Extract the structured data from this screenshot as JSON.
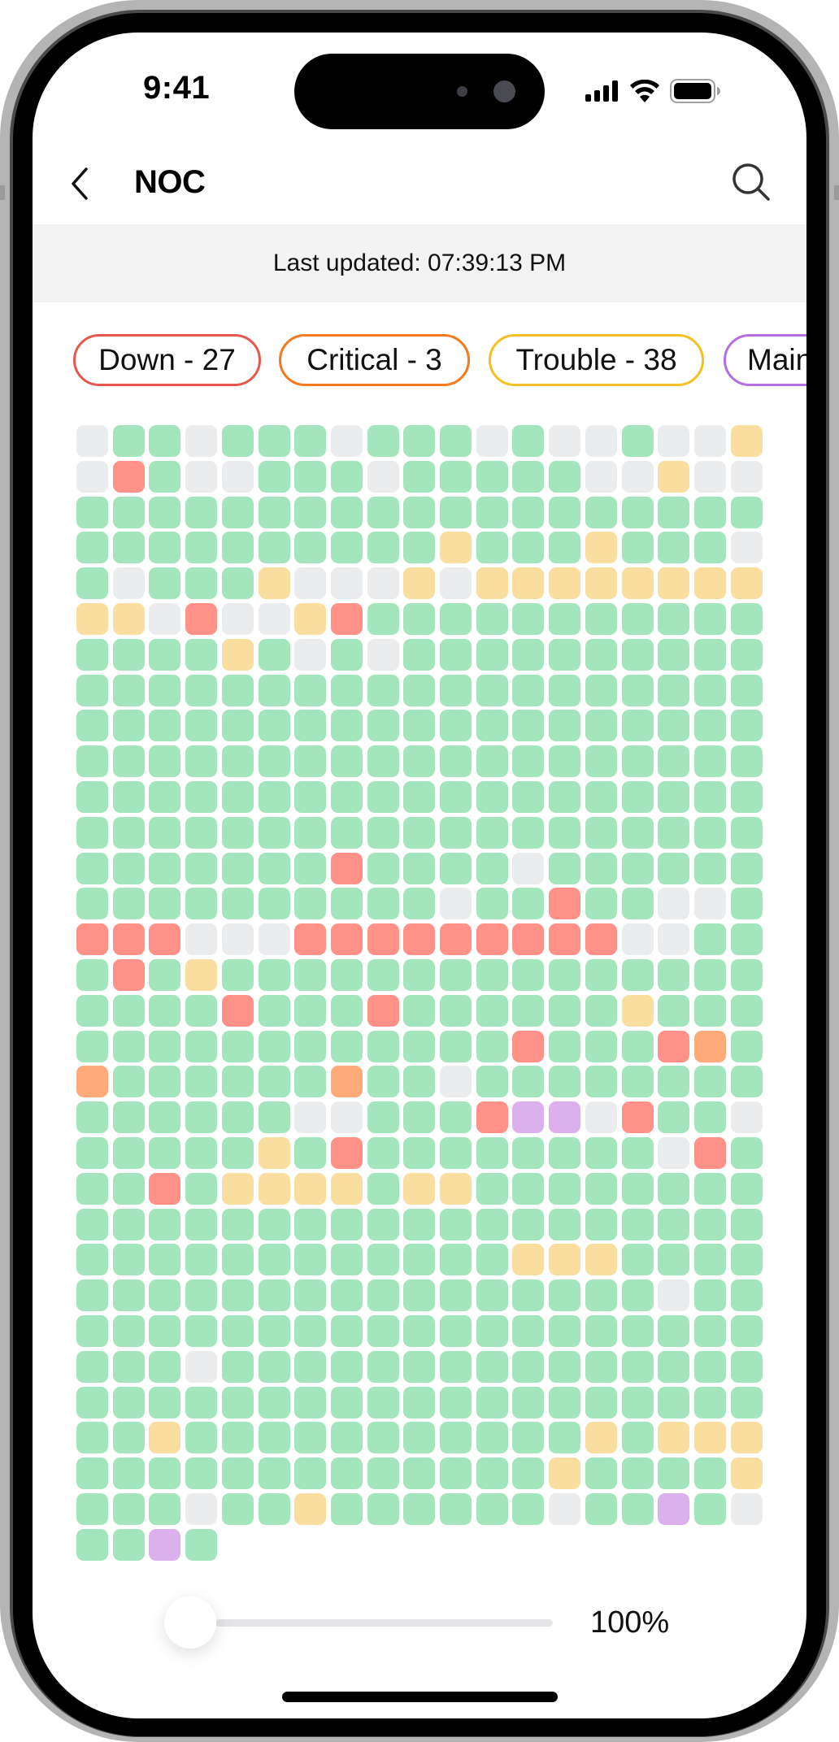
{
  "status_bar": {
    "time": "9:41",
    "icons": [
      "cellular-signal-icon",
      "wifi-icon",
      "battery-icon"
    ]
  },
  "header": {
    "title": "NOC",
    "back_icon": "chevron-left-icon",
    "search_icon": "search-icon"
  },
  "banner": {
    "last_updated": "Last updated: 07:39:13 PM"
  },
  "filters": [
    {
      "label": "Down - 27",
      "status": "down",
      "color": "#e8574c"
    },
    {
      "label": "Critical - 3",
      "status": "critical",
      "color": "#f47a1f"
    },
    {
      "label": "Trouble - 38",
      "status": "trouble",
      "color": "#f5c023"
    },
    {
      "label": "Main",
      "status": "maintenance",
      "color": "#b46ee0"
    }
  ],
  "status_colors": {
    "G": "#a3e5bc",
    "E": "#ebecee",
    "R": "#ff9189",
    "O": "#ffaa78",
    "Y": "#f9dea0",
    "P": "#dcb0ec"
  },
  "status_legend": {
    "G": "up",
    "E": "unknown",
    "R": "down",
    "O": "critical",
    "Y": "trouble",
    "P": "maintenance"
  },
  "grid": {
    "columns": 19,
    "rows": [
      "EGGEGGGEGGGEGEEGEEY",
      "ERGEEGGGEGGGGGEEYEE",
      "GGGGGGGGGGGGGGGGGGG",
      "GGGGGGGGGGYGGGYGGGE",
      "GEGGGYEEEYEYYYYYYYY",
      "YYEREEYRGGGGGGGGGGG",
      "GGGGYGEGEGGGGGGGGGG",
      "GGGGGGGGGGGGGGGGGGG",
      "GGGGGGGGGGGGGGGGGGG",
      "GGGGGGGGGGGGGGGGGGG",
      "GGGGGGGGGGGGGGGGGGG",
      "GGGGGGGGGGGGGGGGGGG",
      "GGGGGGGRGGGGEGGGGGG",
      "GGGGGGGGGGEGGRGGEEG",
      "RRREEERRRRRRRRREEGG",
      "GRGYGGGGGGGGGGGGGGG",
      "GGGGRGGGRGGGGGGYGGG",
      "GGGGGGGGGGGGRGGGROG",
      "OGGGGGGOGGEGGGGGGGG",
      "GGGGGGEEGGGRPPERGGE",
      "GGGGGYGRGGGGGGGGERG",
      "GGRGYYYYGYYGGGGGGGG",
      "GGGGGGGGGGGGGGGGGGG",
      "GGGGGGGGGGGGYYYGGGG",
      "GGGGGGGGGGGGGGGGEGG",
      "GGGGGGGGGGGGGGGGGGG",
      "GGGEGGGGGGGGGGGGGGG",
      "GGGGGGGGGGGGGGGGGGG",
      "GGYGGGGGGGGGGGYGYYY",
      "GGGGGGGGGGGGGYGGGGY",
      "GGGEGGYGGGGGGEGGPGE",
      "GGPG"
    ]
  },
  "zoom": {
    "label": "100%",
    "slider_value_fraction": 0.0
  }
}
